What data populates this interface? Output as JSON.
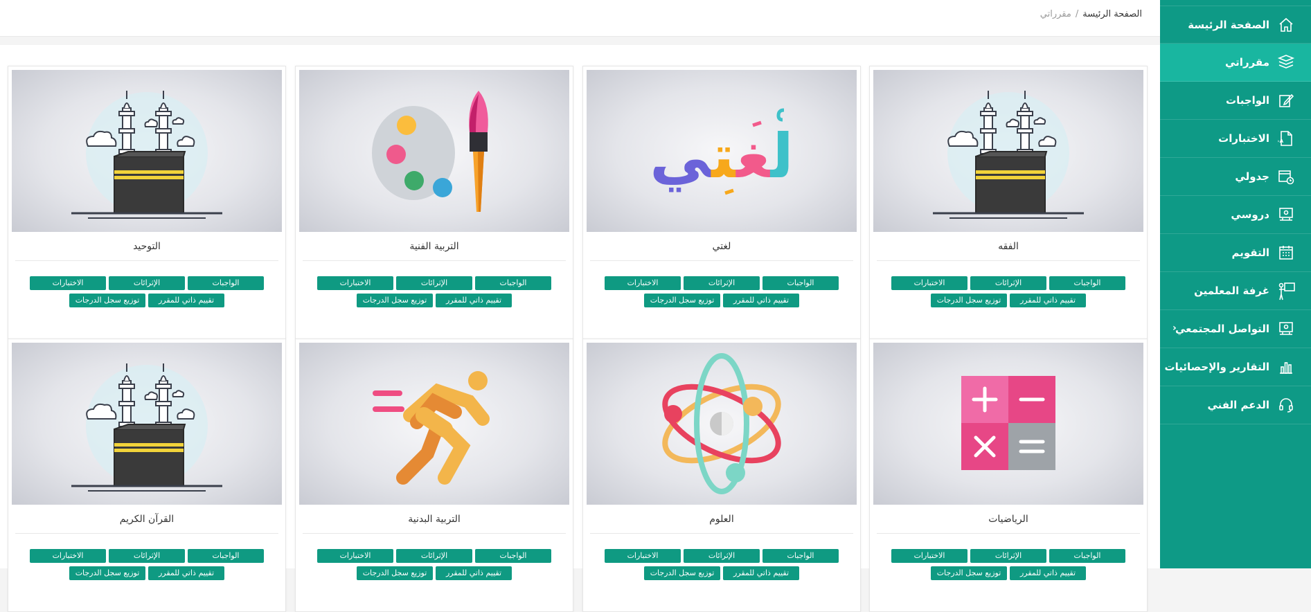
{
  "sidebar": {
    "items": [
      {
        "label": "الصفحة الرئيسة",
        "icon": "home-icon"
      },
      {
        "label": "مقرراتي",
        "icon": "books-icon",
        "active": true
      },
      {
        "label": "الواجبات",
        "icon": "edit-icon"
      },
      {
        "label": "الاختبارات",
        "icon": "test-icon"
      },
      {
        "label": "جدولي",
        "icon": "calendar-clock-icon"
      },
      {
        "label": "دروسي",
        "icon": "lessons-icon"
      },
      {
        "label": "التقويم",
        "icon": "calendar-icon"
      },
      {
        "label": "غرفة المعلمين",
        "icon": "teacher-board-icon"
      },
      {
        "label": "التواصل المجتمعي",
        "icon": "community-icon",
        "has_submenu": true
      },
      {
        "label": "التقارير والإحصائيات",
        "icon": "bar-chart-icon"
      },
      {
        "label": "الدعم الفني",
        "icon": "headset-icon"
      }
    ]
  },
  "breadcrumb": {
    "home": "الصفحة الرئيسة",
    "separator": "/",
    "current": "مقرراتي"
  },
  "card_buttons": {
    "assignments": "الواجبات",
    "enrichments": "الإثرائات",
    "tests": "الاختبارات",
    "self_assessment": "تقييم ذاتي للمقرر",
    "gradebook": "توزيع سجل الدرجات"
  },
  "courses": [
    {
      "title": "الفقه",
      "image": "kaaba"
    },
    {
      "title": "لغتي",
      "image": "lughati"
    },
    {
      "title": "التربية الفنية",
      "image": "palette"
    },
    {
      "title": "التوحيد",
      "image": "kaaba"
    },
    {
      "title": "الرياضيات",
      "image": "calculator"
    },
    {
      "title": "العلوم",
      "image": "atom"
    },
    {
      "title": "التربية البدنية",
      "image": "runner"
    },
    {
      "title": "القرآن الكريم",
      "image": "kaaba"
    }
  ],
  "colors": {
    "sidebar": "#0e9a86",
    "sidebar_active": "#19b6a0",
    "button": "#0f9a82"
  }
}
